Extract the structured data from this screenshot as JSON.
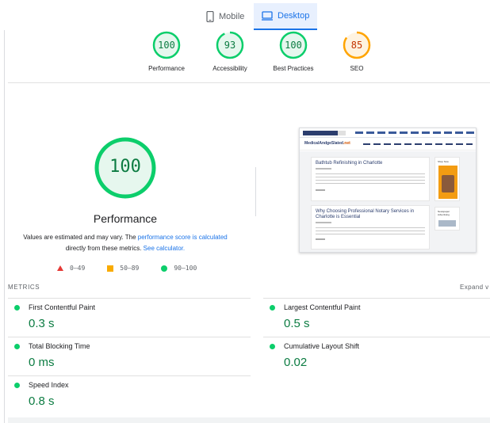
{
  "tabs": [
    {
      "label": "Mobile",
      "icon": "phone-icon",
      "active": false
    },
    {
      "label": "Desktop",
      "icon": "desktop-icon",
      "active": true
    }
  ],
  "summary": [
    {
      "score": "100",
      "label": "Performance",
      "rating": "pass"
    },
    {
      "score": "93",
      "label": "Accessibility",
      "rating": "pass"
    },
    {
      "score": "100",
      "label": "Best Practices",
      "rating": "pass"
    },
    {
      "score": "85",
      "label": "SEO",
      "rating": "average"
    }
  ],
  "performance": {
    "score": "100",
    "title": "Performance",
    "disclaimer_pre": "Values are estimated and may vary. The ",
    "disclaimer_link1": "performance score is calculated",
    "disclaimer_mid": " directly from these metrics. ",
    "disclaimer_link2": "See calculator."
  },
  "legend": {
    "fail": "0–49",
    "average": "50–89",
    "pass": "90–100"
  },
  "screenshot": {
    "logo": "MedicalAndgeSlated",
    "logo_suffix": ".net",
    "post1_title": "Bathtub Refinishing in Charlotte",
    "post2_title": "Why Choosing Professional Notary Services in Charlotte is Essential",
    "sidebar1_title": "Shop Now",
    "sidebar2_title": "Newspaper Advertising"
  },
  "metrics": {
    "heading": "METRICS",
    "expand_label": "Expand v",
    "items": [
      {
        "name": "First Contentful Paint",
        "value": "0.3 s"
      },
      {
        "name": "Largest Contentful Paint",
        "value": "0.5 s"
      },
      {
        "name": "Total Blocking Time",
        "value": "0 ms"
      },
      {
        "name": "Cumulative Layout Shift",
        "value": "0.02"
      },
      {
        "name": "Speed Index",
        "value": "0.8 s"
      }
    ]
  },
  "colors": {
    "pass": "#0cce6b",
    "average": "#ffa400",
    "fail": "#ff4e42",
    "accent": "#1a73e8"
  }
}
